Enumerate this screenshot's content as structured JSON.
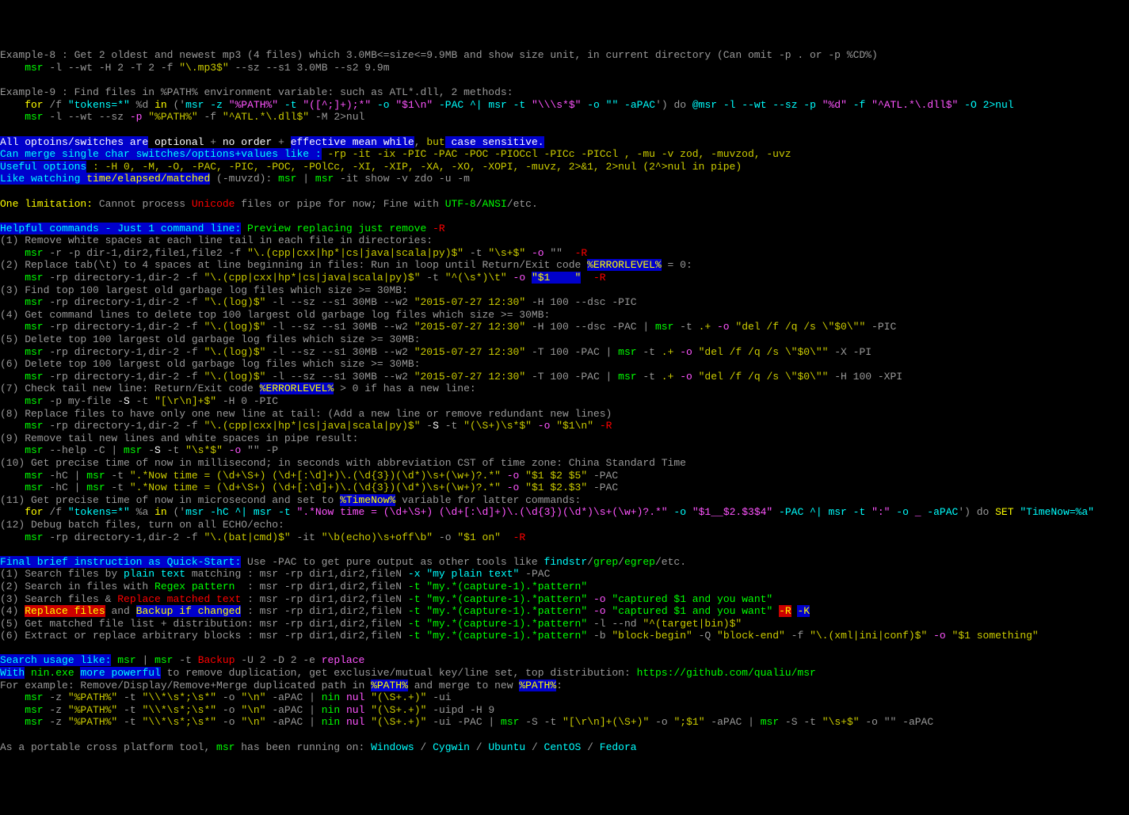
{
  "l1": {
    "p1": "Example-8 : Get 2 oldest and newest mp3 (4 files) which 3.0MB<=size<=9.9MB and show size unit, in current directory (Can omit -p . or -p %CD%)"
  },
  "l2": {
    "p1": "    msr",
    "p2": " -l --wt -H 2 -T 2 -f ",
    "p3": "\"\\.mp3$\"",
    "p4": " --sz --s1 3.0MB --s2 9.9m"
  },
  "l3": "",
  "l4": {
    "p1": "Example-9 : Find files in %PATH% environment variable: such as ATL*.dll, 2 methods:"
  },
  "l5": {
    "p1": "    for",
    "p2": " /f ",
    "p3": "\"tokens=*\"",
    "p4": " %d ",
    "p5": "in",
    "p6": " ('",
    "p7": "msr -z ",
    "p8": "\"%PATH%\"",
    "p9": " -t ",
    "p10": "\"([^;]+);*\"",
    "p11": " -o ",
    "p12": "\"$1\\n\"",
    "p13": " -PAC ^| msr -t ",
    "p14": "\"\\\\\\s*$\"",
    "p15": " -o \"\" -aPAC",
    "p16": "') do ",
    "p17": "@msr -l --wt --sz -p ",
    "p18": "\"%d\"",
    "p19": " -f ",
    "p20": "\"^ATL.*\\.dll$\"",
    "p21": " -O 2>nul"
  },
  "l6": {
    "p1": "    msr",
    "p2": " -l --wt --sz ",
    "p3": "-p",
    "p4": " ",
    "p5": "\"%PATH%\"",
    "p6": " -f ",
    "p7": "\"^ATL.*\\.dll$\"",
    "p8": " -M 2>nul"
  },
  "l7": "",
  "l8": {
    "p1": "All optoins/switches are",
    "p2": " optional",
    "p3": " + ",
    "p4": "no order",
    "p5": " + ",
    "p6": "effective mean while",
    "p7": ", ",
    "p8": "but",
    "p9": " case sensitive."
  },
  "l9": {
    "p1": "Can merge single char switches/options+values like :",
    "p2": " -rp -it -ix -PIC -PAC -POC -PIOCcl -PICc -PICcl , -mu -v zod, -muvzod, -uvz"
  },
  "l10": {
    "p1": "Useful options",
    "p2": " : -H 0, -M, -O, -PAC, -PIC, -POC, -POlCc, -XI, -XIP, -XA, -XO, -XOPI, -muvz, 2>&1, 2>nul (2^>nul in pipe)"
  },
  "l11": {
    "p1": "Like watching",
    "p2": " time/elapsed/matched",
    "p3": " (-muvzd): ",
    "p4": "msr",
    "p5": " | ",
    "p6": "msr",
    "p7": " -it show -v zdo -u -m"
  },
  "l12": "",
  "l13": {
    "p1": "One limitation:",
    "p2": " Cannot process ",
    "p3": "Unicode",
    "p4": " files or pipe for now; Fine with ",
    "p5": "UTF-8",
    "p6": "/",
    "p7": "ANSI",
    "p8": "/etc."
  },
  "l14": "",
  "l15": {
    "p1": "Helpful commands - Just 1 command line:",
    "p2": " Preview replacing just remove ",
    "p3": "-R"
  },
  "l16": {
    "p1": "(1) Remove white spaces at each line tail in each file in directories:"
  },
  "l17": {
    "p1": "    msr",
    "p2": " -r -p dir-1,dir2,file1,file2 -f ",
    "p3": "\"\\.(cpp|cxx|hp*|cs|java|scala|py)$\"",
    "p4": " -t ",
    "p5": "\"\\s+$\"",
    "p6": " -o",
    "p7": " \"\"  ",
    "p8": "-R"
  },
  "l18": {
    "p1": "(2) Replace tab(\\t) to 4 spaces at line beginning in files: Run in loop until Return/Exit code ",
    "p2": "%ERRORLEVEL%",
    "p3": " = 0:"
  },
  "l19": {
    "p1": "    msr",
    "p2": " -rp directory-1,dir-2 -f ",
    "p3": "\"\\.(cpp|cxx|hp*|cs|java|scala|py)$\"",
    "p4": " -t ",
    "p5": "\"^(\\s*)\\t\"",
    "p6": " -o",
    "p7": " ",
    "p8": "\"$1    \"",
    "p9": "  ",
    "p10": "-R"
  },
  "l20": {
    "p1": "(3) Find top 100 largest old garbage log files which size >= 30MB:"
  },
  "l21": {
    "p1": "    msr",
    "p2": " -rp directory-1,dir-2 -f ",
    "p3": "\"\\.(log)$\"",
    "p4": " -l --sz --s1 30MB --w2 ",
    "p5": "\"2015-07-27 12:30\"",
    "p6": " -H 100 --dsc -PIC"
  },
  "l22": {
    "p1": "(4) Get command lines to delete top 100 largest old garbage log files which size >= 30MB:"
  },
  "l23": {
    "p1": "    msr",
    "p2": " -rp directory-1,dir-2 -f ",
    "p3": "\"\\.(log)$\"",
    "p4": " -l --sz --s1 30MB --w2 ",
    "p5": "\"2015-07-27 12:30\"",
    "p6": " -H 100 --dsc -PAC | ",
    "p7": "msr",
    "p8": " -t ",
    "p9": ".+",
    "p10": " -o",
    "p11": " ",
    "p12": "\"del /f /q /s \\\"$0\\\"\"",
    "p13": " -PIC"
  },
  "l24": {
    "p1": "(5) Delete top 100 largest old garbage log files which size >= 30MB:"
  },
  "l25": {
    "p1": "    msr",
    "p2": " -rp directory-1,dir-2 -f ",
    "p3": "\"\\.(log)$\"",
    "p4": " -l --sz --s1 30MB --w2 ",
    "p5": "\"2015-07-27 12:30\"",
    "p6": " -T 100 -PAC | ",
    "p7": "msr",
    "p8": " -t ",
    "p9": ".+",
    "p10": " -o",
    "p11": " ",
    "p12": "\"del /f /q /s \\\"$0\\\"\"",
    "p13": " -X -PI"
  },
  "l26": {
    "p1": "(6) Delete top 100 largest old garbage log files which size >= 30MB:"
  },
  "l27": {
    "p1": "    msr",
    "p2": " -rp directory-1,dir-2 -f ",
    "p3": "\"\\.(log)$\"",
    "p4": " -l --sz --s1 30MB --w2 ",
    "p5": "\"2015-07-27 12:30\"",
    "p6": " -T 100 -PAC | ",
    "p7": "msr",
    "p8": " -t ",
    "p9": ".+",
    "p10": " -o",
    "p11": " ",
    "p12": "\"del /f /q /s \\\"$0\\\"\"",
    "p13": " -H 100 -XPI"
  },
  "l28": {
    "p1": "(7) Check tail new line: Return/Exit code ",
    "p2": "%ERRORLEVEL%",
    "p3": " > 0 if has a new line:"
  },
  "l29": {
    "p1": "    msr",
    "p2": " -p my-file -",
    "p3": "S",
    "p4": " -t ",
    "p5": "\"[\\r\\n]+$\"",
    "p6": " -H 0 -PIC"
  },
  "l30": {
    "p1": "(8) Replace files to have only one new line at tail: (Add a new line or remove redundant new lines)"
  },
  "l31": {
    "p1": "    msr",
    "p2": " -rp directory-1,dir-2 -f ",
    "p3": "\"\\.(cpp|cxx|hp*|cs|java|scala|py)$\"",
    "p4": " -",
    "p5": "S",
    "p6": " -t ",
    "p7": "\"(\\S+)\\s*$\"",
    "p8": " -o",
    "p9": " ",
    "p10": "\"$1\\n\"",
    "p11": " ",
    "p12": "-R"
  },
  "l32": {
    "p1": "(9) Remove tail new lines and white spaces in pipe result:"
  },
  "l33": {
    "p1": "    msr",
    "p2": " --help -C | ",
    "p3": "msr",
    "p4": " -",
    "p5": "S",
    "p6": " -t ",
    "p7": "\"\\s*$\"",
    "p8": " -o",
    "p9": " \"\" -P"
  },
  "l34": {
    "p1": "(10) Get precise time of now in millisecond; in seconds with abbreviation CST of time zone: China Standard Time"
  },
  "l35": {
    "p1": "    msr",
    "p2": " -hC | ",
    "p3": "msr",
    "p4": " -t ",
    "p5": "\".*Now time = (\\d+\\S+) (\\d+[:\\d]+)\\.(\\d{3})(\\d*)\\s+(\\w+)?.*\"",
    "p6": " -o",
    "p7": " ",
    "p8": "\"$1 $2 $5\"",
    "p9": " -PAC"
  },
  "l36": {
    "p1": "    msr",
    "p2": " -hC | ",
    "p3": "msr",
    "p4": " -t ",
    "p5": "\".*Now time = (\\d+\\S+) (\\d+[:\\d]+)\\.(\\d{3})(\\d*)\\s+(\\w+)?.*\"",
    "p6": " -o",
    "p7": " ",
    "p8": "\"$1 $2.$3\"",
    "p9": " -PAC"
  },
  "l37": {
    "p1": "(11) Get precise time of now in microsecond and set to ",
    "p2": "%TimeNow%",
    "p3": " variable for latter commands:"
  },
  "l38": {
    "p1": "    for",
    "p2": " /f ",
    "p3": "\"tokens=*\"",
    "p4": " %a ",
    "p5": "in",
    "p6": " ('",
    "p7": "msr -hC ^| msr -t ",
    "p8": "\".*Now time = (\\d+\\S+) (\\d+[:\\d]+)\\.(\\d{3})(\\d*)\\s+(\\w+)?.*\"",
    "p9": " -o ",
    "p10": "\"$1__$2.$3$4\"",
    "p11": " -PAC ^| msr -t ",
    "p12": "\":\"",
    "p13": " -o ",
    "p14": "_",
    "p15": " -aPAC",
    "p16": "') do ",
    "p17": "SET",
    "p18": " ",
    "p19": "\"TimeNow=%a\""
  },
  "l39": {
    "p1": "(12) Debug batch files, turn on all ECHO/echo:"
  },
  "l40": {
    "p1": "    msr",
    "p2": " -rp directory-1,dir-2 -f ",
    "p3": "\"\\.(bat|cmd)$\"",
    "p4": " -it ",
    "p5": "\"\\b(echo)\\s+off\\b\"",
    "p6": " -o ",
    "p7": "\"$1 on\"",
    "p8": "  ",
    "p9": "-R"
  },
  "l41": "",
  "l42": {
    "p1": "Final brief instruction as Quick-Start:",
    "p2": " Use -PAC to get pure output as other tools like ",
    "p3": "findstr",
    "p4": "/",
    "p5": "grep",
    "p6": "/",
    "p7": "egrep",
    "p8": "/etc."
  },
  "l43": {
    "p1": "(1) Search files by ",
    "p2": "plain text",
    "p3": " matching : msr -rp dir1,dir2,fileN ",
    "p4": "-x",
    "p5": " ",
    "p6": "\"my plain text\"",
    "p7": " -PAC"
  },
  "l44": {
    "p1": "(2) Search in files with ",
    "p2": "Regex pattern",
    "p3": "  : msr -rp dir1,dir2,fileN ",
    "p4": "-t",
    "p5": " ",
    "p6": "\"my.*(capture-1).*pattern\""
  },
  "l45": {
    "p1": "(3) Search files & ",
    "p2": "Replace matched text",
    "p3": " : msr -rp dir1,dir2,fileN ",
    "p4": "-t",
    "p5": " ",
    "p6": "\"my.*(capture-1).*pattern\"",
    "p7": " -o",
    "p8": " ",
    "p9": "\"captured $1 and you want\""
  },
  "l46": {
    "p1": "(4) ",
    "p2": "Replace files",
    "p3": " and ",
    "p4": "Backup if changed",
    "p5": " : msr -rp dir1,dir2,fileN ",
    "p6": "-t",
    "p7": " ",
    "p8": "\"my.*(capture-1).*pattern\"",
    "p9": " -o",
    "p10": " ",
    "p11": "\"captured $1 and you want\"",
    "p12": " ",
    "p13": "-R",
    "p14": " ",
    "p15": "-K"
  },
  "l47": {
    "p1": "(5) Get matched file list + distribution: msr -rp dir1,dir2,fileN ",
    "p2": "-t",
    "p3": " ",
    "p4": "\"my.*(capture-1).*pattern\"",
    "p5": " -l --nd ",
    "p6": "\"^(target|bin)$\""
  },
  "l48": {
    "p1": "(6) Extract or replace arbitrary blocks : msr -rp dir1,dir2,fileN ",
    "p2": "-t",
    "p3": " ",
    "p4": "\"my.*(capture-1).*pattern\"",
    "p5": " -b ",
    "p6": "\"block-begin\"",
    "p7": " -Q ",
    "p8": "\"block-end\"",
    "p9": " -f ",
    "p10": "\"\\.(xml|ini|conf)$\"",
    "p11": " -o",
    "p12": " ",
    "p13": "\"$1 something\""
  },
  "l49": "",
  "l50": {
    "p1": "Search usage like:",
    "p2": " ",
    "p3": "msr",
    "p4": " | ",
    "p5": "msr",
    "p6": " -t ",
    "p7": "Backup",
    "p8": " -U 2 -D 2 -e ",
    "p9": "replace"
  },
  "l51": {
    "p1": "With",
    "p2": " nin.exe ",
    "p3": "more powerful",
    "p4": " to remove duplication, get exclusive/mutual key/line set, top distribution: ",
    "p5": "https://github.com/qualiu/msr"
  },
  "l52": {
    "p1": "For example: Remove/Display/Remove+Merge duplicated path in ",
    "p2": "%PATH%",
    "p3": " and merge to new ",
    "p4": "%PATH%",
    "p5": ":"
  },
  "l53": {
    "p1": "    msr",
    "p2": " -z ",
    "p3": "\"%PATH%\"",
    "p4": " -t ",
    "p5": "\"\\\\*\\s*;\\s*\"",
    "p6": " -o ",
    "p7": "\"\\n\"",
    "p8": " -aPAC | ",
    "p9": "nin",
    "p10": " ",
    "p11": "nul",
    "p12": " ",
    "p13": "\"(\\S+.+)\"",
    "p14": " -ui"
  },
  "l54": {
    "p1": "    msr",
    "p2": " -z ",
    "p3": "\"%PATH%\"",
    "p4": " -t ",
    "p5": "\"\\\\*\\s*;\\s*\"",
    "p6": " -o ",
    "p7": "\"\\n\"",
    "p8": " -aPAC | ",
    "p9": "nin",
    "p10": " ",
    "p11": "nul",
    "p12": " ",
    "p13": "\"(\\S+.+)\"",
    "p14": " -uipd -H 9"
  },
  "l55": {
    "p1": "    msr",
    "p2": " -z ",
    "p3": "\"%PATH%\"",
    "p4": " -t ",
    "p5": "\"\\\\*\\s*;\\s*\"",
    "p6": " -o ",
    "p7": "\"\\n\"",
    "p8": " -aPAC | ",
    "p9": "nin",
    "p10": " ",
    "p11": "nul",
    "p12": " ",
    "p13": "\"(\\S+.+)\"",
    "p14": " -ui -PAC | ",
    "p15": "msr",
    "p16": " -S -t ",
    "p17": "\"[\\r\\n]+(\\S+)\"",
    "p18": " -o ",
    "p19": "\";$1\"",
    "p20": " -aPAC | ",
    "p21": "msr",
    "p22": " -S -t ",
    "p23": "\"\\s+$\"",
    "p24": " -o \"\" -aPAC"
  },
  "l56": "",
  "l57": {
    "p1": "As a portable cross platform tool, ",
    "p2": "msr",
    "p3": " has been running on: ",
    "p4": "Windows",
    "p5": " / ",
    "p6": "Cygwin",
    "p7": " / ",
    "p8": "Ubuntu",
    "p9": " / ",
    "p10": "CentOS",
    "p11": " / ",
    "p12": "Fedora"
  }
}
